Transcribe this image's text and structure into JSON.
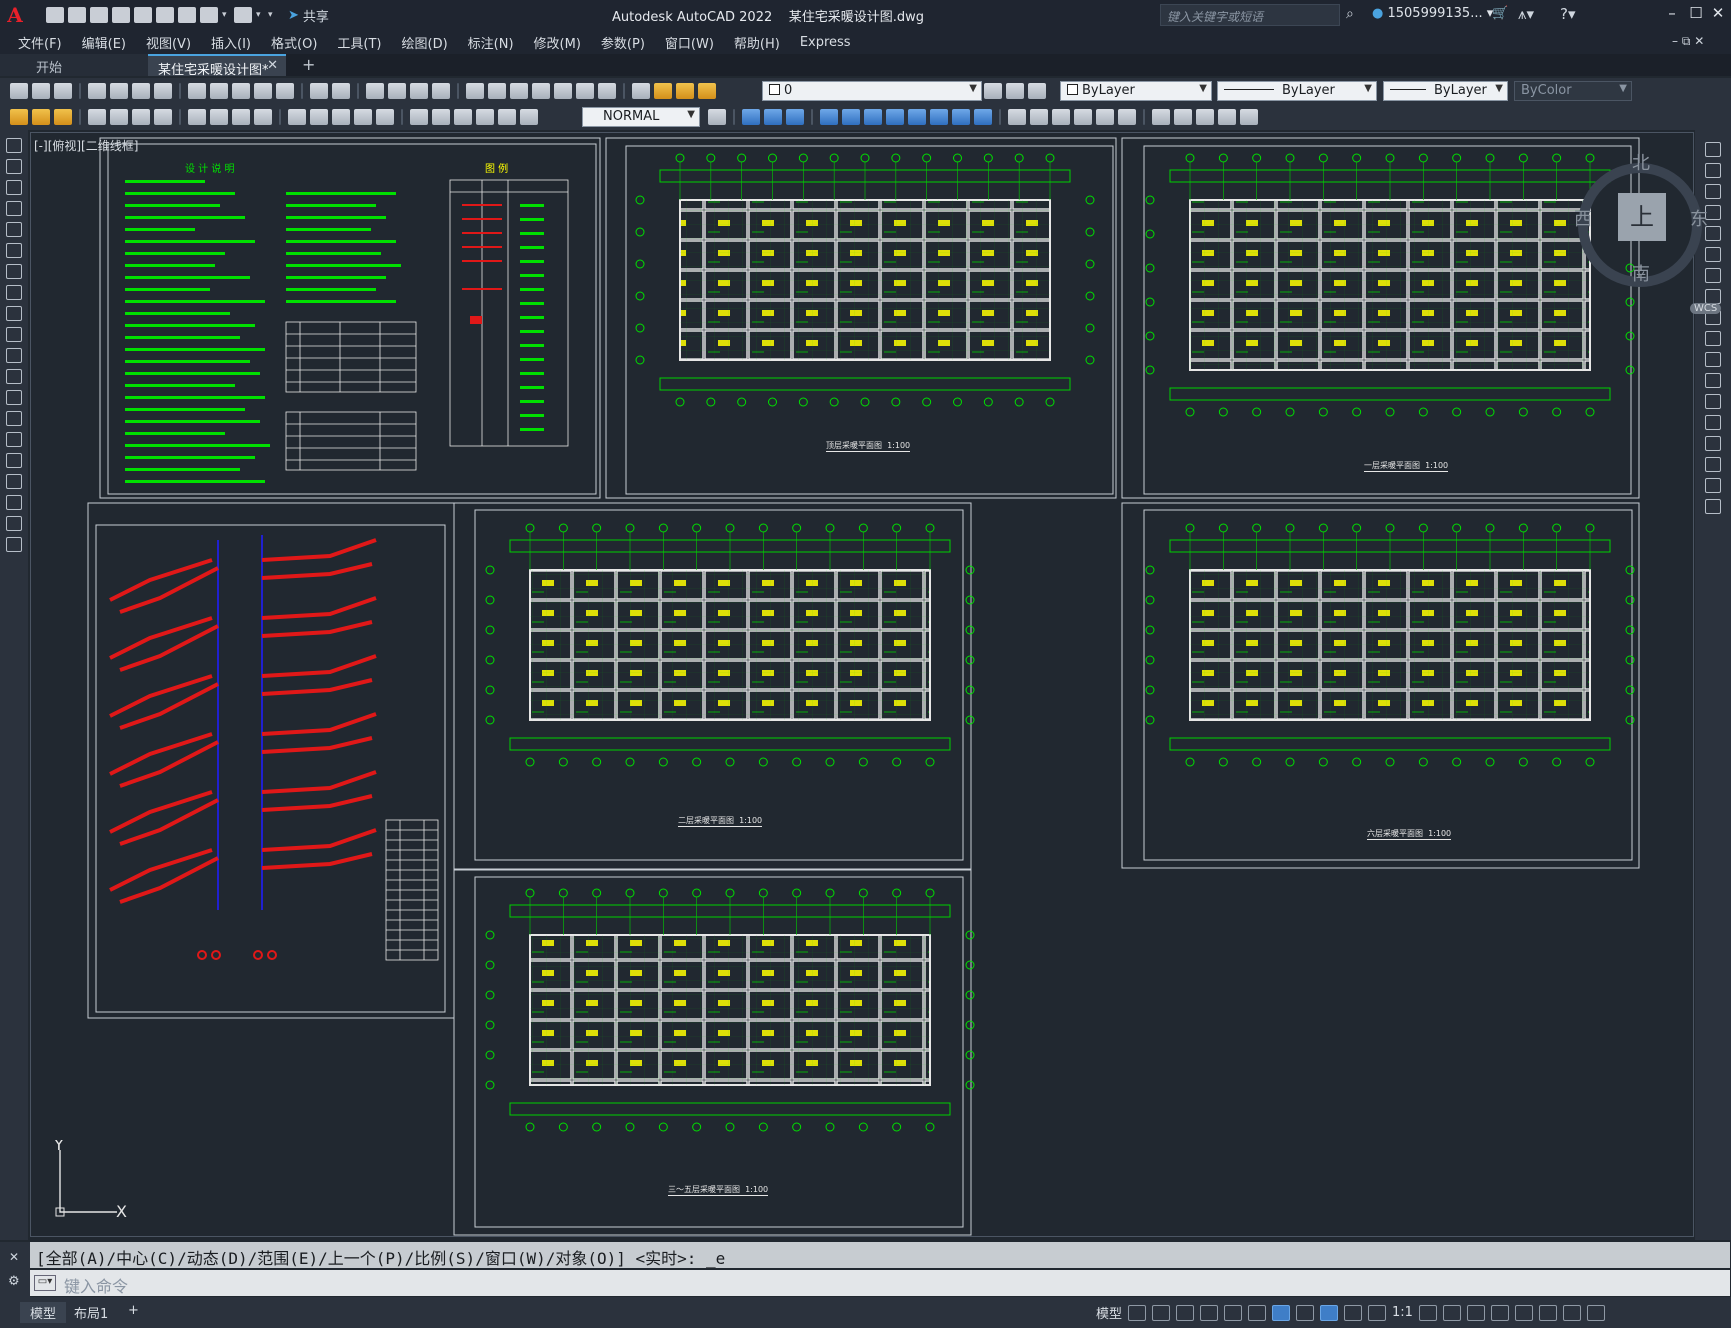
{
  "window": {
    "title": "Autodesk AutoCAD 2022    某住宅采暖设计图.dwg",
    "search_placeholder": "键入关键字或短语",
    "user": "1505999135...",
    "share": "共享"
  },
  "menu": [
    "文件(F)",
    "编辑(E)",
    "视图(V)",
    "插入(I)",
    "格式(O)",
    "工具(T)",
    "绘图(D)",
    "标注(N)",
    "修改(M)",
    "参数(P)",
    "窗口(W)",
    "帮助(H)",
    "Express"
  ],
  "tabs": {
    "start": "开始",
    "active": "某住宅采暖设计图*"
  },
  "properties": {
    "layer": "0",
    "style": "NORMAL",
    "color": "ByLayer",
    "linetype": "ByLayer",
    "lineweight": "ByLayer",
    "plotstyle": "ByColor"
  },
  "viewport_label": "[-][俯视][二维线框]",
  "viewcube": {
    "top": "上",
    "north": "北",
    "south": "南",
    "east": "东",
    "west": "西",
    "wcs": "WCS"
  },
  "ucs": {
    "x": "X",
    "y": "Y"
  },
  "command": {
    "history": "[全部(A)/中心(C)/动态(D)/范围(E)/上一个(P)/比例(S)/窗口(W)/对象(O)] <实时>: _e",
    "placeholder": "键入命令"
  },
  "status": {
    "model_tab": "模型",
    "layout_tab": "布局1",
    "model_btn": "模型",
    "scale": "1:1"
  },
  "drawings": {
    "titles": [
      "顶层采暖平面图  1:100",
      "一层采暖平面图  1:100",
      "二层采暖平面图  1:100",
      "六层采暖平面图  1:100",
      "三～五层采暖平面图  1:100"
    ],
    "legend_title": "图  例",
    "notes_title": "设 计 说 明"
  },
  "colors": {
    "canvas": "#212830",
    "drawing_line": "#00e000",
    "wall": "#e8e8e8",
    "pipe_red": "#e01818",
    "pipe_blue": "#2020d0",
    "accent_yellow": "#ffff00"
  }
}
